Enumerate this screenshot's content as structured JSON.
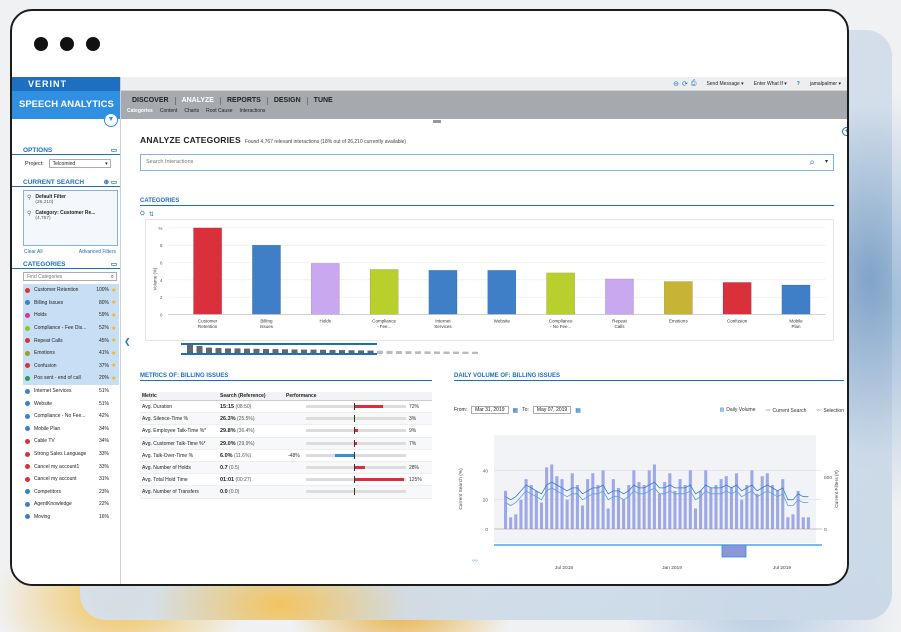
{
  "app": {
    "brand": "VERINT",
    "product": "SPEECH ANALYTICS"
  },
  "topbar": {
    "send_message": "Send Message",
    "enter_what_if": "Enter What If",
    "help": "?",
    "user": "jamalpalmer"
  },
  "nav": {
    "tabs": [
      {
        "label": "DISCOVER",
        "active": false
      },
      {
        "label": "ANALYZE",
        "active": true
      },
      {
        "label": "REPORTS",
        "active": false
      },
      {
        "label": "DESIGN",
        "active": false
      },
      {
        "label": "TUNE",
        "active": false
      }
    ],
    "subtabs": [
      {
        "label": "Categories",
        "active": true
      },
      {
        "label": "Content",
        "active": false
      },
      {
        "label": "Charts",
        "active": false
      },
      {
        "label": "Root Cause",
        "active": false
      },
      {
        "label": "Interactions",
        "active": false
      }
    ]
  },
  "options": {
    "title": "OPTIONS",
    "project_label": "Project:",
    "project_value": "Telcomind"
  },
  "current_search": {
    "title": "CURRENT SEARCH",
    "filters": [
      {
        "title": "Default Filter",
        "count": "(26,210)"
      },
      {
        "title": "Category: Customer Re...",
        "count": "(4,767)"
      }
    ],
    "clear_all": "Clear All",
    "advanced": "Advanced Filters"
  },
  "categories_panel": {
    "title": "CATEGORIES",
    "find_placeholder": "Find Categories",
    "items": [
      {
        "name": "Customer Retention",
        "pct": "100%",
        "color": "#d9303b",
        "hl": true,
        "star": true
      },
      {
        "name": "Billing Issues",
        "pct": "80%",
        "color": "#3e7fc8",
        "hl": true,
        "star": true
      },
      {
        "name": "Holds",
        "pct": "59%",
        "color": "#d03b9b",
        "hl": true,
        "star": true
      },
      {
        "name": "Compliance - Fee Dis...",
        "pct": "52%",
        "color": "#95c12d",
        "hl": true,
        "star": true
      },
      {
        "name": "Repeat Calls",
        "pct": "45%",
        "color": "#d9303b",
        "hl": true,
        "star": true
      },
      {
        "name": "Emotions",
        "pct": "41%",
        "color": "#96a12a",
        "hl": true,
        "star": true
      },
      {
        "name": "Confusion",
        "pct": "37%",
        "color": "#d9303b",
        "hl": true,
        "star": true
      },
      {
        "name": "Pos sent - end of call",
        "pct": "20%",
        "color": "#2a9a55",
        "hl": true,
        "star": true
      },
      {
        "name": "Internet Services",
        "pct": "51%",
        "color": "#3e7fc8",
        "hl": false,
        "star": false
      },
      {
        "name": "Website",
        "pct": "51%",
        "color": "#3e7fc8",
        "hl": false,
        "star": false
      },
      {
        "name": "Compliance - No Fee...",
        "pct": "42%",
        "color": "#3e7fc8",
        "hl": false,
        "star": false
      },
      {
        "name": "Mobile Plan",
        "pct": "34%",
        "color": "#3e7fc8",
        "hl": false,
        "star": false
      },
      {
        "name": "Cable TV",
        "pct": "34%",
        "color": "#d9303b",
        "hl": false,
        "star": false
      },
      {
        "name": "Strong Sales Language",
        "pct": "33%",
        "color": "#d9303b",
        "hl": false,
        "star": false
      },
      {
        "name": "Cancel my account1",
        "pct": "33%",
        "color": "#d9303b",
        "hl": false,
        "star": false
      },
      {
        "name": "Cancel my account",
        "pct": "31%",
        "color": "#d9303b",
        "hl": false,
        "star": false
      },
      {
        "name": "Competitors",
        "pct": "23%",
        "color": "#3e7fc8",
        "hl": false,
        "star": false
      },
      {
        "name": "AgentKnowledge",
        "pct": "22%",
        "color": "#3e7fc8",
        "hl": false,
        "star": false
      },
      {
        "name": "Moving",
        "pct": "16%",
        "color": "#3e7fc8",
        "hl": false,
        "star": false
      }
    ]
  },
  "main": {
    "title": "ANALYZE CATEGORIES",
    "subtitle": "Found 4,767 relevant interactions (18% out of 26,210 currently available)",
    "search_placeholder": "Search Interactions",
    "categories_header": "CATEGORIES",
    "metrics_header": "METRICS OF:  BILLING ISSUES",
    "daily_header": "DAILY VOLUME OF:  BILLING ISSUES"
  },
  "chart_data": [
    {
      "type": "bar",
      "ylabel": "Volume (%)",
      "ylim": [
        0,
        100
      ],
      "yticks": [
        "%",
        "8",
        "6",
        "4",
        "2",
        "0"
      ],
      "grid": true,
      "categories": [
        "Customer Retention",
        "Billing Issues",
        "Holds",
        "Compliance - Fee...",
        "Internet Services",
        "Website",
        "Compliance - No Fee...",
        "Repeat Calls",
        "Emotions",
        "Confusion",
        "Mobile Plan"
      ],
      "values": [
        100,
        80,
        59,
        52,
        51,
        51,
        48,
        41,
        38,
        37,
        34
      ],
      "colors": [
        "#d9303b",
        "#3e7fc8",
        "#c9a8ef",
        "#b8cf2e",
        "#3e7fc8",
        "#3e7fc8",
        "#b8cf2e",
        "#c9a8ef",
        "#c7b334",
        "#d9303b",
        "#3e7fc8"
      ],
      "preview_values": [
        95,
        75,
        55,
        50,
        45,
        45,
        42,
        40,
        38,
        36,
        34,
        32,
        30,
        30,
        28,
        26,
        24,
        22,
        20,
        18,
        16,
        14,
        12,
        10,
        9,
        8,
        7,
        6,
        5,
        4,
        3,
        3
      ]
    },
    {
      "type": "bar",
      "title": "Daily Volume",
      "ylabel": "Current Search (%)",
      "y2label": "Current Filters (#)",
      "ylim": [
        0,
        60
      ],
      "yticks": [
        0,
        20,
        40
      ],
      "y2ticks": [
        0,
        500
      ],
      "xticks": [
        "Jul 2018",
        "Jan 2019",
        "Jul 2019"
      ],
      "grid": true,
      "from_label": "From:",
      "from_date": "Mar 31, 2019",
      "to_label": "To:",
      "to_date": "May 07, 2019",
      "legend": [
        "Daily Volume",
        "Current Search",
        "Selection"
      ],
      "values": [
        26,
        8,
        10,
        20,
        34,
        30,
        26,
        18,
        42,
        44,
        36,
        34,
        20,
        38,
        30,
        16,
        34,
        38,
        30,
        40,
        14,
        34,
        28,
        20,
        30,
        40,
        32,
        30,
        40,
        44,
        24,
        32,
        38,
        26,
        34,
        30,
        40,
        14,
        26,
        40,
        28,
        30,
        34,
        36,
        28,
        38,
        20,
        30,
        40,
        24,
        36,
        38,
        30,
        26,
        34,
        8,
        10,
        26,
        8,
        8
      ],
      "line1": [
        22,
        20,
        22,
        26,
        30,
        28,
        26,
        24,
        30,
        32,
        30,
        28,
        26,
        28,
        28,
        24,
        26,
        28,
        28,
        30,
        24,
        26,
        26,
        24,
        26,
        30,
        28,
        28,
        30,
        32,
        28,
        28,
        30,
        28,
        28,
        28,
        30,
        24,
        26,
        30,
        28,
        28,
        28,
        30,
        28,
        30,
        26,
        28,
        30,
        26,
        28,
        30,
        28,
        26,
        28,
        20,
        20,
        24,
        22,
        22
      ],
      "line2": [
        18,
        16,
        18,
        22,
        26,
        24,
        22,
        20,
        26,
        28,
        26,
        24,
        22,
        24,
        24,
        20,
        22,
        24,
        24,
        26,
        20,
        22,
        22,
        20,
        22,
        26,
        24,
        24,
        26,
        28,
        24,
        24,
        26,
        24,
        24,
        24,
        26,
        20,
        22,
        26,
        24,
        24,
        24,
        26,
        24,
        26,
        22,
        24,
        26,
        22,
        24,
        26,
        24,
        22,
        24,
        16,
        16,
        20,
        18,
        18
      ]
    }
  ],
  "metrics": {
    "headers": [
      "Metric",
      "Search (Reference)",
      "Performance"
    ],
    "rows": [
      {
        "metric": "Avg. Duration",
        "value": "15:15",
        "ref": "(08:50)",
        "perf": 72,
        "label": "72%"
      },
      {
        "metric": "Avg. Silence-Time %",
        "value": "26.3%",
        "ref": "(25.5%)",
        "perf": 3,
        "label": "3%"
      },
      {
        "metric": "Avg. Employee Talk-Time %*",
        "value": "29.8%",
        "ref": "(36.4%)",
        "perf": 9,
        "label": "9%"
      },
      {
        "metric": "Avg. Customer Talk-Time %*",
        "value": "29.0%",
        "ref": "(29.9%)",
        "perf": 7,
        "label": "7%"
      },
      {
        "metric": "Avg. Talk-Over-Time %",
        "value": "6.0%",
        "ref": "(11.6%)",
        "perf": -48,
        "label": "-48%"
      },
      {
        "metric": "Avg. Number of Holds",
        "value": "0.7",
        "ref": "(0.5)",
        "perf": 28,
        "label": "28%"
      },
      {
        "metric": "Avg. Total Hold Time",
        "value": "01:01",
        "ref": "(00:27)",
        "perf": 125,
        "label": "125%"
      },
      {
        "metric": "Avg. Number of Transfers",
        "value": "0.0",
        "ref": "(0.0)",
        "perf": 0,
        "label": ""
      }
    ]
  }
}
